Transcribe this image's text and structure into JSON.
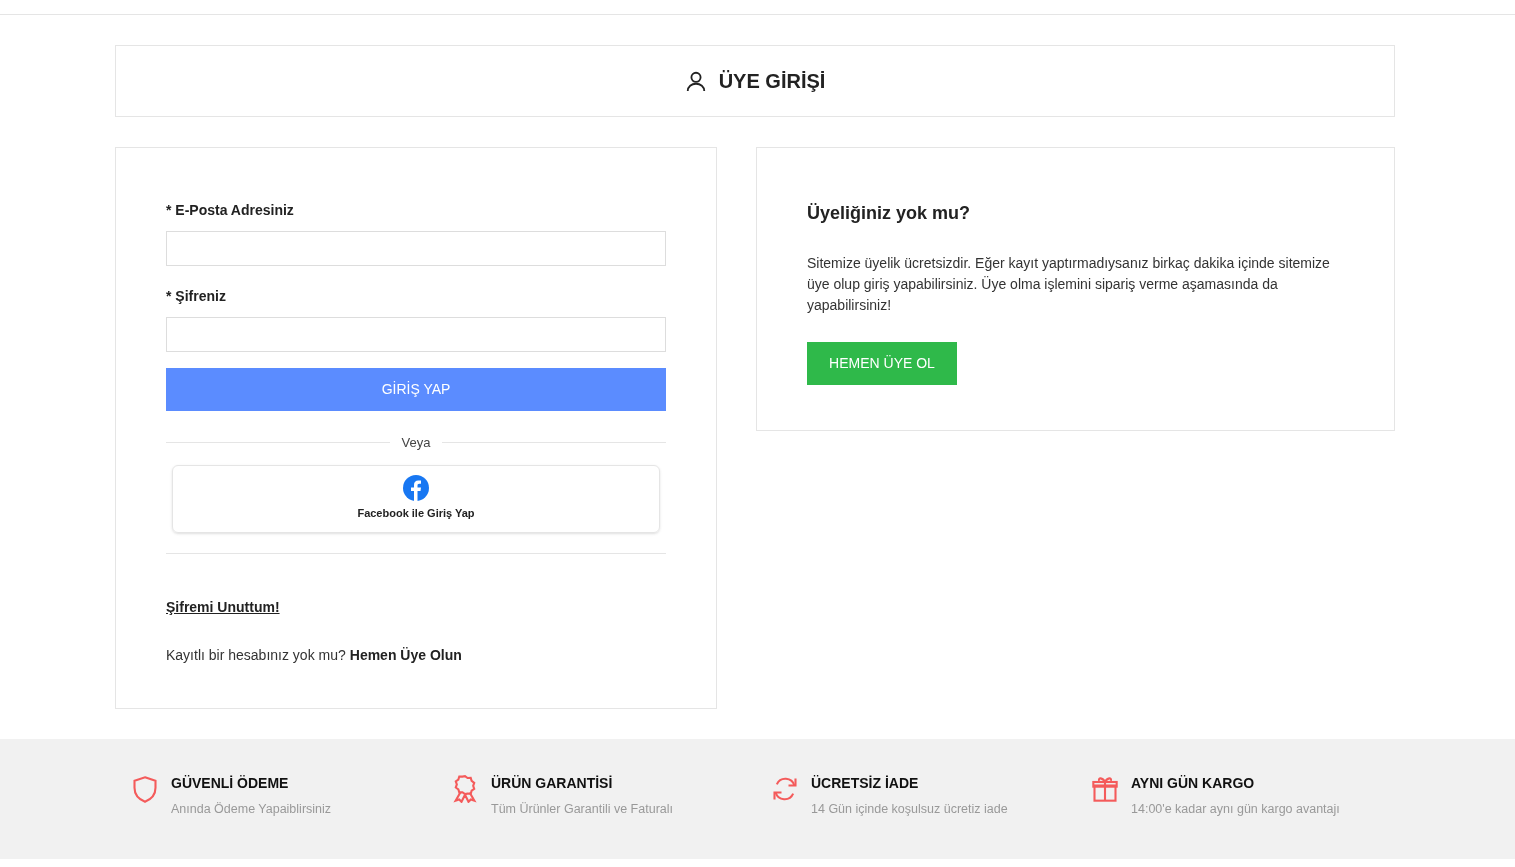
{
  "header": {
    "title": "ÜYE GİRİŞİ"
  },
  "login": {
    "fields": [
      {
        "label": "* E-Posta Adresiniz"
      },
      {
        "label": "* Şifreniz"
      }
    ],
    "submit": "GİRİŞ YAP",
    "divider": "Veya",
    "facebook": "Facebook ile Giriş Yap",
    "forgot": "Şifremi Unuttum!",
    "register_prompt": "Kayıtlı bir hesabınız yok mu?",
    "register_link": "Hemen Üye Olun"
  },
  "signup": {
    "title": "Üyeliğiniz yok mu?",
    "text": "Sitemize üyelik ücretsizdir. Eğer kayıt yaptırmadıysanız birkaç dakika içinde sitemize üye olup giriş yapabilirsiniz. Üye olma işlemini sipariş verme aşamasında da yapabilirsiniz!",
    "button": "HEMEN ÜYE OL"
  },
  "features": [
    {
      "kind": "shield",
      "title": "GÜVENLİ ÖDEME",
      "text": "Anında Ödeme Yapaiblirsiniz"
    },
    {
      "kind": "award",
      "title": "ÜRÜN GARANTİSİ",
      "text": "Tüm Ürünler Garantili ve Faturalı"
    },
    {
      "kind": "refresh",
      "title": "ÜCRETSİZ İADE",
      "text": "14 Gün içinde koşulsuz ücretiz iade"
    },
    {
      "kind": "gift",
      "title": "AYNI GÜN KARGO",
      "text": "14:00'e kadar aynı gün kargo avantajı"
    }
  ]
}
